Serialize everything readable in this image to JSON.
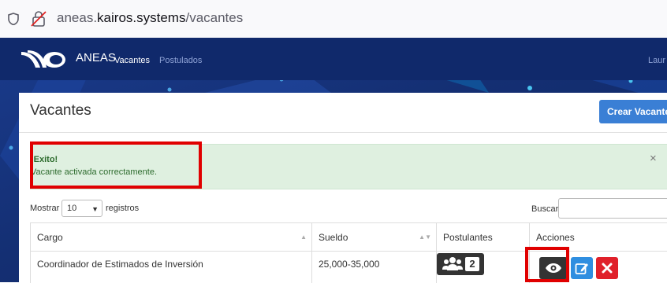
{
  "browser": {
    "url_prefix": "aneas.",
    "url_host": "kairos.systems",
    "url_path": "/vacantes"
  },
  "navbar": {
    "brand": "ANEAS",
    "links": [
      "Vacantes",
      "Postulados"
    ],
    "user": "Laur"
  },
  "page": {
    "title": "Vacantes",
    "create_button": "Crear Vacante"
  },
  "alert": {
    "title": "¡Exito!",
    "message": "Vacante activada correctamente.",
    "close": "×"
  },
  "controls": {
    "show_label": "Mostrar",
    "page_size": "10",
    "records_label": "registros",
    "search_label": "Buscar"
  },
  "table": {
    "headers": [
      "Cargo",
      "Sueldo",
      "Postulantes",
      "Acciones"
    ],
    "rows": [
      {
        "cargo": "Coordinador de Estimados de Inversión",
        "sueldo": "25,000-35,000",
        "postulantes": "2"
      }
    ]
  },
  "colors": {
    "navbar": "#10296b",
    "primary": "#3a7fd5",
    "success_bg": "#dff0e0",
    "danger": "#e0202a",
    "highlight": "#e00000"
  },
  "icons": [
    "shield-icon",
    "lock-off-icon",
    "users-icon",
    "eye-icon",
    "edit-icon",
    "delete-icon"
  ]
}
